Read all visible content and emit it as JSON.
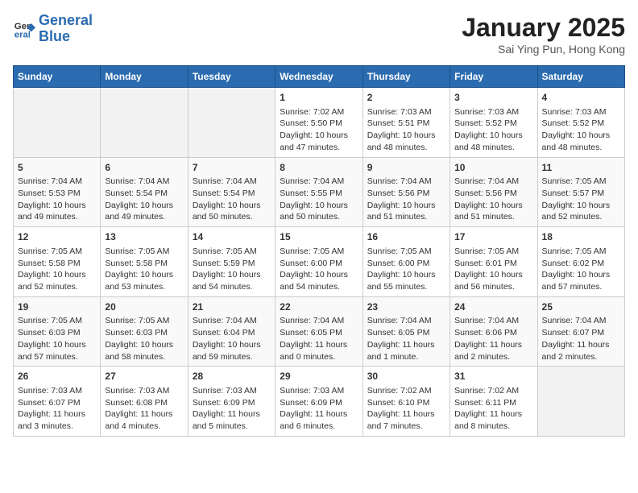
{
  "header": {
    "logo_line1": "General",
    "logo_line2": "Blue",
    "month": "January 2025",
    "location": "Sai Ying Pun, Hong Kong"
  },
  "weekdays": [
    "Sunday",
    "Monday",
    "Tuesday",
    "Wednesday",
    "Thursday",
    "Friday",
    "Saturday"
  ],
  "weeks": [
    [
      {
        "day": "",
        "info": ""
      },
      {
        "day": "",
        "info": ""
      },
      {
        "day": "",
        "info": ""
      },
      {
        "day": "1",
        "info": "Sunrise: 7:02 AM\nSunset: 5:50 PM\nDaylight: 10 hours\nand 47 minutes."
      },
      {
        "day": "2",
        "info": "Sunrise: 7:03 AM\nSunset: 5:51 PM\nDaylight: 10 hours\nand 48 minutes."
      },
      {
        "day": "3",
        "info": "Sunrise: 7:03 AM\nSunset: 5:52 PM\nDaylight: 10 hours\nand 48 minutes."
      },
      {
        "day": "4",
        "info": "Sunrise: 7:03 AM\nSunset: 5:52 PM\nDaylight: 10 hours\nand 48 minutes."
      }
    ],
    [
      {
        "day": "5",
        "info": "Sunrise: 7:04 AM\nSunset: 5:53 PM\nDaylight: 10 hours\nand 49 minutes."
      },
      {
        "day": "6",
        "info": "Sunrise: 7:04 AM\nSunset: 5:54 PM\nDaylight: 10 hours\nand 49 minutes."
      },
      {
        "day": "7",
        "info": "Sunrise: 7:04 AM\nSunset: 5:54 PM\nDaylight: 10 hours\nand 50 minutes."
      },
      {
        "day": "8",
        "info": "Sunrise: 7:04 AM\nSunset: 5:55 PM\nDaylight: 10 hours\nand 50 minutes."
      },
      {
        "day": "9",
        "info": "Sunrise: 7:04 AM\nSunset: 5:56 PM\nDaylight: 10 hours\nand 51 minutes."
      },
      {
        "day": "10",
        "info": "Sunrise: 7:04 AM\nSunset: 5:56 PM\nDaylight: 10 hours\nand 51 minutes."
      },
      {
        "day": "11",
        "info": "Sunrise: 7:05 AM\nSunset: 5:57 PM\nDaylight: 10 hours\nand 52 minutes."
      }
    ],
    [
      {
        "day": "12",
        "info": "Sunrise: 7:05 AM\nSunset: 5:58 PM\nDaylight: 10 hours\nand 52 minutes."
      },
      {
        "day": "13",
        "info": "Sunrise: 7:05 AM\nSunset: 5:58 PM\nDaylight: 10 hours\nand 53 minutes."
      },
      {
        "day": "14",
        "info": "Sunrise: 7:05 AM\nSunset: 5:59 PM\nDaylight: 10 hours\nand 54 minutes."
      },
      {
        "day": "15",
        "info": "Sunrise: 7:05 AM\nSunset: 6:00 PM\nDaylight: 10 hours\nand 54 minutes."
      },
      {
        "day": "16",
        "info": "Sunrise: 7:05 AM\nSunset: 6:00 PM\nDaylight: 10 hours\nand 55 minutes."
      },
      {
        "day": "17",
        "info": "Sunrise: 7:05 AM\nSunset: 6:01 PM\nDaylight: 10 hours\nand 56 minutes."
      },
      {
        "day": "18",
        "info": "Sunrise: 7:05 AM\nSunset: 6:02 PM\nDaylight: 10 hours\nand 57 minutes."
      }
    ],
    [
      {
        "day": "19",
        "info": "Sunrise: 7:05 AM\nSunset: 6:03 PM\nDaylight: 10 hours\nand 57 minutes."
      },
      {
        "day": "20",
        "info": "Sunrise: 7:05 AM\nSunset: 6:03 PM\nDaylight: 10 hours\nand 58 minutes."
      },
      {
        "day": "21",
        "info": "Sunrise: 7:04 AM\nSunset: 6:04 PM\nDaylight: 10 hours\nand 59 minutes."
      },
      {
        "day": "22",
        "info": "Sunrise: 7:04 AM\nSunset: 6:05 PM\nDaylight: 11 hours\nand 0 minutes."
      },
      {
        "day": "23",
        "info": "Sunrise: 7:04 AM\nSunset: 6:05 PM\nDaylight: 11 hours\nand 1 minute."
      },
      {
        "day": "24",
        "info": "Sunrise: 7:04 AM\nSunset: 6:06 PM\nDaylight: 11 hours\nand 2 minutes."
      },
      {
        "day": "25",
        "info": "Sunrise: 7:04 AM\nSunset: 6:07 PM\nDaylight: 11 hours\nand 2 minutes."
      }
    ],
    [
      {
        "day": "26",
        "info": "Sunrise: 7:03 AM\nSunset: 6:07 PM\nDaylight: 11 hours\nand 3 minutes."
      },
      {
        "day": "27",
        "info": "Sunrise: 7:03 AM\nSunset: 6:08 PM\nDaylight: 11 hours\nand 4 minutes."
      },
      {
        "day": "28",
        "info": "Sunrise: 7:03 AM\nSunset: 6:09 PM\nDaylight: 11 hours\nand 5 minutes."
      },
      {
        "day": "29",
        "info": "Sunrise: 7:03 AM\nSunset: 6:09 PM\nDaylight: 11 hours\nand 6 minutes."
      },
      {
        "day": "30",
        "info": "Sunrise: 7:02 AM\nSunset: 6:10 PM\nDaylight: 11 hours\nand 7 minutes."
      },
      {
        "day": "31",
        "info": "Sunrise: 7:02 AM\nSunset: 6:11 PM\nDaylight: 11 hours\nand 8 minutes."
      },
      {
        "day": "",
        "info": ""
      }
    ]
  ]
}
